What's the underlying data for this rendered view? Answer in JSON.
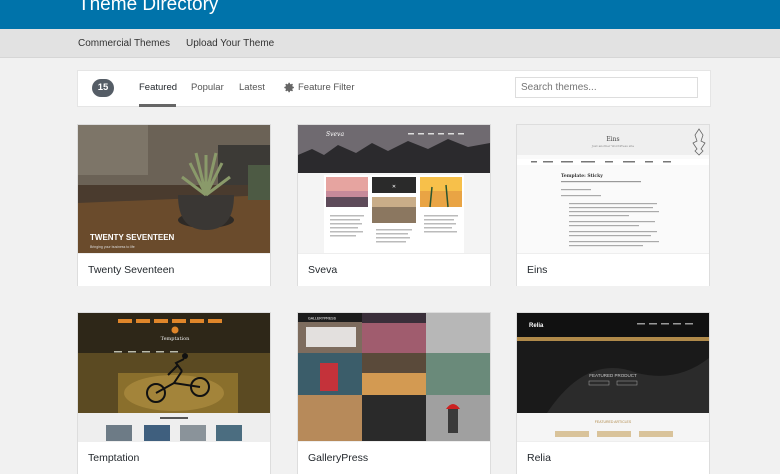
{
  "header": {
    "title": "Theme Directory"
  },
  "subnav": {
    "commercial": "Commercial Themes",
    "upload": "Upload Your Theme"
  },
  "filter": {
    "count": "15",
    "tabs": [
      "Featured",
      "Popular",
      "Latest"
    ],
    "feature_filter": "Feature Filter",
    "search_placeholder": "Search themes..."
  },
  "themes": [
    {
      "name": "Twenty Seventeen",
      "shot_title": "TWENTY SEVENTEEN",
      "shot_sub": "Bringing your business to life"
    },
    {
      "name": "Sveva",
      "shot_title": "Sveva"
    },
    {
      "name": "Eins",
      "shot_title": "Eins",
      "shot_sub": "Just another WordPress site",
      "shot_heading": "Template: Sticky"
    },
    {
      "name": "Temptation",
      "shot_title": "Temptation"
    },
    {
      "name": "GalleryPress",
      "shot_title": "GALLERYPRESS"
    },
    {
      "name": "Relia",
      "shot_title": "Relia",
      "shot_sub": "FEATURED PRODUCT",
      "shot_heading": "FEATURED ARTICLES"
    }
  ],
  "colors": {
    "accent": "#0073aa",
    "badge": "#555d66"
  }
}
